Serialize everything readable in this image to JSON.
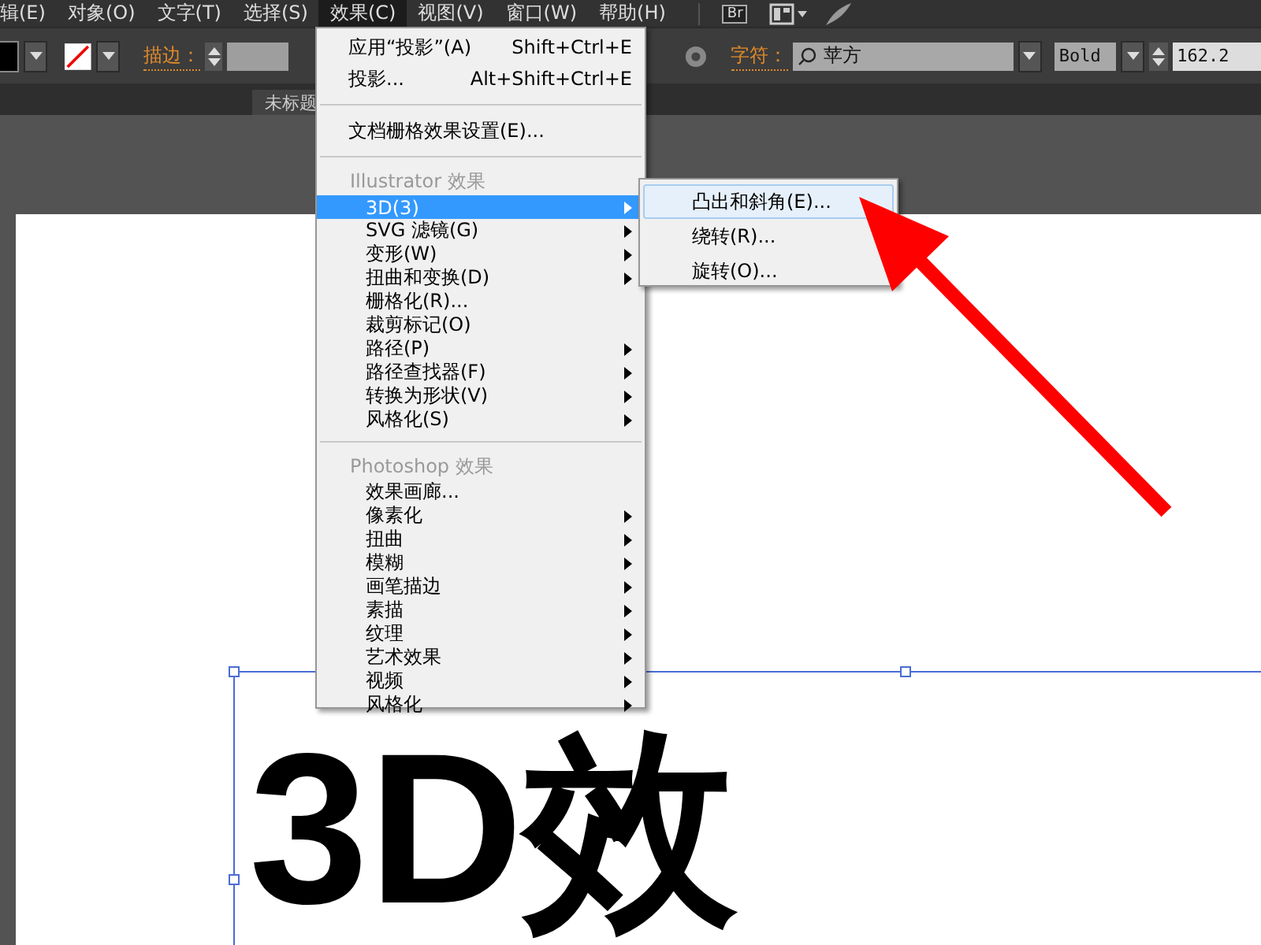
{
  "menubar": {
    "items": [
      {
        "label": "辑(E)",
        "selected": false
      },
      {
        "label": "对象(O)",
        "selected": false
      },
      {
        "label": "文字(T)",
        "selected": false
      },
      {
        "label": "选择(S)",
        "selected": false
      },
      {
        "label": "效果(C)",
        "selected": true
      },
      {
        "label": "视图(V)",
        "selected": false
      },
      {
        "label": "窗口(W)",
        "selected": false
      },
      {
        "label": "帮助(H)",
        "selected": false
      }
    ],
    "bridge_button": "Br"
  },
  "control_bar": {
    "stroke_label": "描边：",
    "character_label": "字符：",
    "font_field": {
      "value": "苹方"
    },
    "style_field": {
      "value": "Bold"
    },
    "size_field": {
      "value": "162.2"
    }
  },
  "document_tab": {
    "title": "未标题"
  },
  "effect_menu": {
    "items": [
      {
        "kind": "item",
        "label": "应用“投影”(A)",
        "shortcut": "Shift+Ctrl+E",
        "submenu": false,
        "selected": false
      },
      {
        "kind": "item",
        "label": "投影...",
        "shortcut": "Alt+Shift+Ctrl+E",
        "submenu": false,
        "selected": false
      },
      {
        "kind": "separator"
      },
      {
        "kind": "item",
        "label": "文档栅格效果设置(E)...",
        "submenu": false,
        "selected": false
      },
      {
        "kind": "separator"
      },
      {
        "kind": "header",
        "label": "Illustrator 效果"
      },
      {
        "kind": "subitem",
        "label": "3D(3)",
        "submenu": true,
        "selected": true
      },
      {
        "kind": "subitem",
        "label": "SVG 滤镜(G)",
        "submenu": true,
        "selected": false
      },
      {
        "kind": "subitem",
        "label": "变形(W)",
        "submenu": true,
        "selected": false
      },
      {
        "kind": "subitem",
        "label": "扭曲和变换(D)",
        "submenu": true,
        "selected": false
      },
      {
        "kind": "subitem",
        "label": "栅格化(R)...",
        "submenu": false,
        "selected": false
      },
      {
        "kind": "subitem",
        "label": "裁剪标记(O)",
        "submenu": false,
        "selected": false
      },
      {
        "kind": "subitem",
        "label": "路径(P)",
        "submenu": true,
        "selected": false
      },
      {
        "kind": "subitem",
        "label": "路径查找器(F)",
        "submenu": true,
        "selected": false
      },
      {
        "kind": "subitem",
        "label": "转换为形状(V)",
        "submenu": true,
        "selected": false
      },
      {
        "kind": "subitem",
        "label": "风格化(S)",
        "submenu": true,
        "selected": false
      },
      {
        "kind": "separator"
      },
      {
        "kind": "header",
        "label": "Photoshop 效果"
      },
      {
        "kind": "subitem",
        "label": "效果画廊...",
        "submenu": false,
        "selected": false
      },
      {
        "kind": "subitem",
        "label": "像素化",
        "submenu": true,
        "selected": false
      },
      {
        "kind": "subitem",
        "label": "扭曲",
        "submenu": true,
        "selected": false
      },
      {
        "kind": "subitem",
        "label": "模糊",
        "submenu": true,
        "selected": false
      },
      {
        "kind": "subitem",
        "label": "画笔描边",
        "submenu": true,
        "selected": false
      },
      {
        "kind": "subitem",
        "label": "素描",
        "submenu": true,
        "selected": false
      },
      {
        "kind": "subitem",
        "label": "纹理",
        "submenu": true,
        "selected": false
      },
      {
        "kind": "subitem",
        "label": "艺术效果",
        "submenu": true,
        "selected": false
      },
      {
        "kind": "subitem",
        "label": "视频",
        "submenu": true,
        "selected": false
      },
      {
        "kind": "subitem",
        "label": "风格化",
        "submenu": true,
        "selected": false
      }
    ]
  },
  "submenu_3d": {
    "items": [
      {
        "label": "凸出和斜角(E)...",
        "selected": true
      },
      {
        "label": "绕转(R)...",
        "selected": false
      },
      {
        "label": "旋转(O)...",
        "selected": false
      }
    ]
  },
  "artboard": {
    "text": "3D效"
  }
}
